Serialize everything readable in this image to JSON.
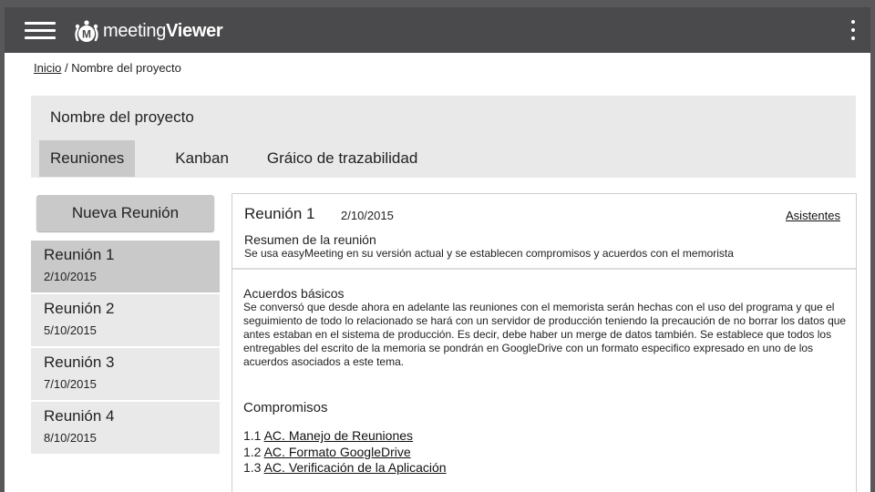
{
  "app": {
    "brand_light": "meeting",
    "brand_bold": "Viewer",
    "logo_letter": "M"
  },
  "icons": {
    "menu": "hamburger-menu-icon",
    "logo": "meeting-logo-icon",
    "overflow": "more-vertical-icon"
  },
  "colors": {
    "topbar": "#4a4a4c",
    "panel": "#e9e9e9",
    "selected": "#c9c9c9"
  },
  "breadcrumb": {
    "home": "Inicio",
    "separator": "/",
    "current": "Nombre del proyecto"
  },
  "project": {
    "title": "Nombre del proyecto",
    "tabs": [
      {
        "label": "Reuniones",
        "active": true
      },
      {
        "label": "Kanban",
        "active": false
      },
      {
        "label": "Gráico de trazabilidad",
        "active": false
      }
    ]
  },
  "sidebar": {
    "new_meeting": "Nueva Reunión",
    "meetings": [
      {
        "title": "Reunión 1",
        "date": "2/10/2015",
        "selected": true
      },
      {
        "title": "Reunión 2",
        "date": "5/10/2015",
        "selected": false
      },
      {
        "title": "Reunión 3",
        "date": "7/10/2015",
        "selected": false
      },
      {
        "title": "Reunión 4",
        "date": "8/10/2015",
        "selected": false
      }
    ]
  },
  "detail": {
    "title": "Reunión 1",
    "date": "2/10/2015",
    "attendees": "Asistentes",
    "summary_title": "Resumen de la reunión",
    "summary_text": "Se usa easyMeeting en su versión actual y se establecen compromisos y acuerdos con el memorista",
    "agreements_title": "Acuerdos básicos",
    "agreements_text": "Se conversó que desde ahora en adelante las reuniones con el memorista serán hechas con el uso del programa y que el seguimiento de todo lo relacionado se hará con un servidor de producción teniendo la precaución de no borrar los datos que antes estaban en el sistema de producción. Es decir, debe haber un merge de datos también. Se establece que todos los entregables del escrito de la memoria se pondrán en GoogleDrive con un formato especifico expresado en uno de los acuerdos asociados a este tema.",
    "commitments_title": "Compromisos",
    "commitments": [
      {
        "num": "1.1",
        "label": "AC. Manejo de Reuniones"
      },
      {
        "num": "1.2",
        "label": "AC. Formato GoogleDrive"
      },
      {
        "num": "1.3",
        "label": "AC. Verificación de la Aplicación"
      }
    ]
  }
}
